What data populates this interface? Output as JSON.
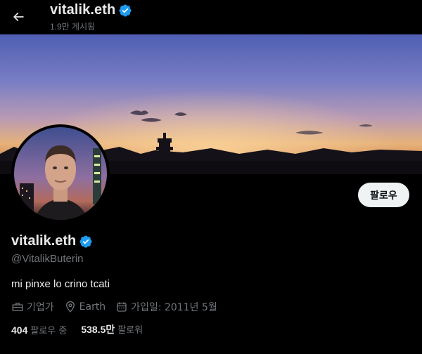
{
  "header": {
    "name": "vitalik.eth",
    "posts_count": "1.9만 게시됨"
  },
  "profile": {
    "display_name": "vitalik.eth",
    "handle": "@VitalikButerin",
    "bio": "mi pinxe lo crino tcati",
    "category": "기업가",
    "location": "Earth",
    "joined": "가입일: 2011년 5월"
  },
  "actions": {
    "follow_label": "팔로우"
  },
  "counts": {
    "following_num": "404",
    "following_label": "팔로우 중",
    "followers_num": "538.5만",
    "followers_label": "팔로워"
  },
  "colors": {
    "background": "#000000",
    "primary_text": "#e7e9ea",
    "secondary_text": "#71767b",
    "verified_badge": "#1d9bf0",
    "follow_button_bg": "#eff3f4"
  },
  "icons": {
    "back": "arrow-left-icon",
    "verified": "verified-badge-icon",
    "category": "briefcase-icon",
    "location": "location-pin-icon",
    "joined": "calendar-icon"
  }
}
